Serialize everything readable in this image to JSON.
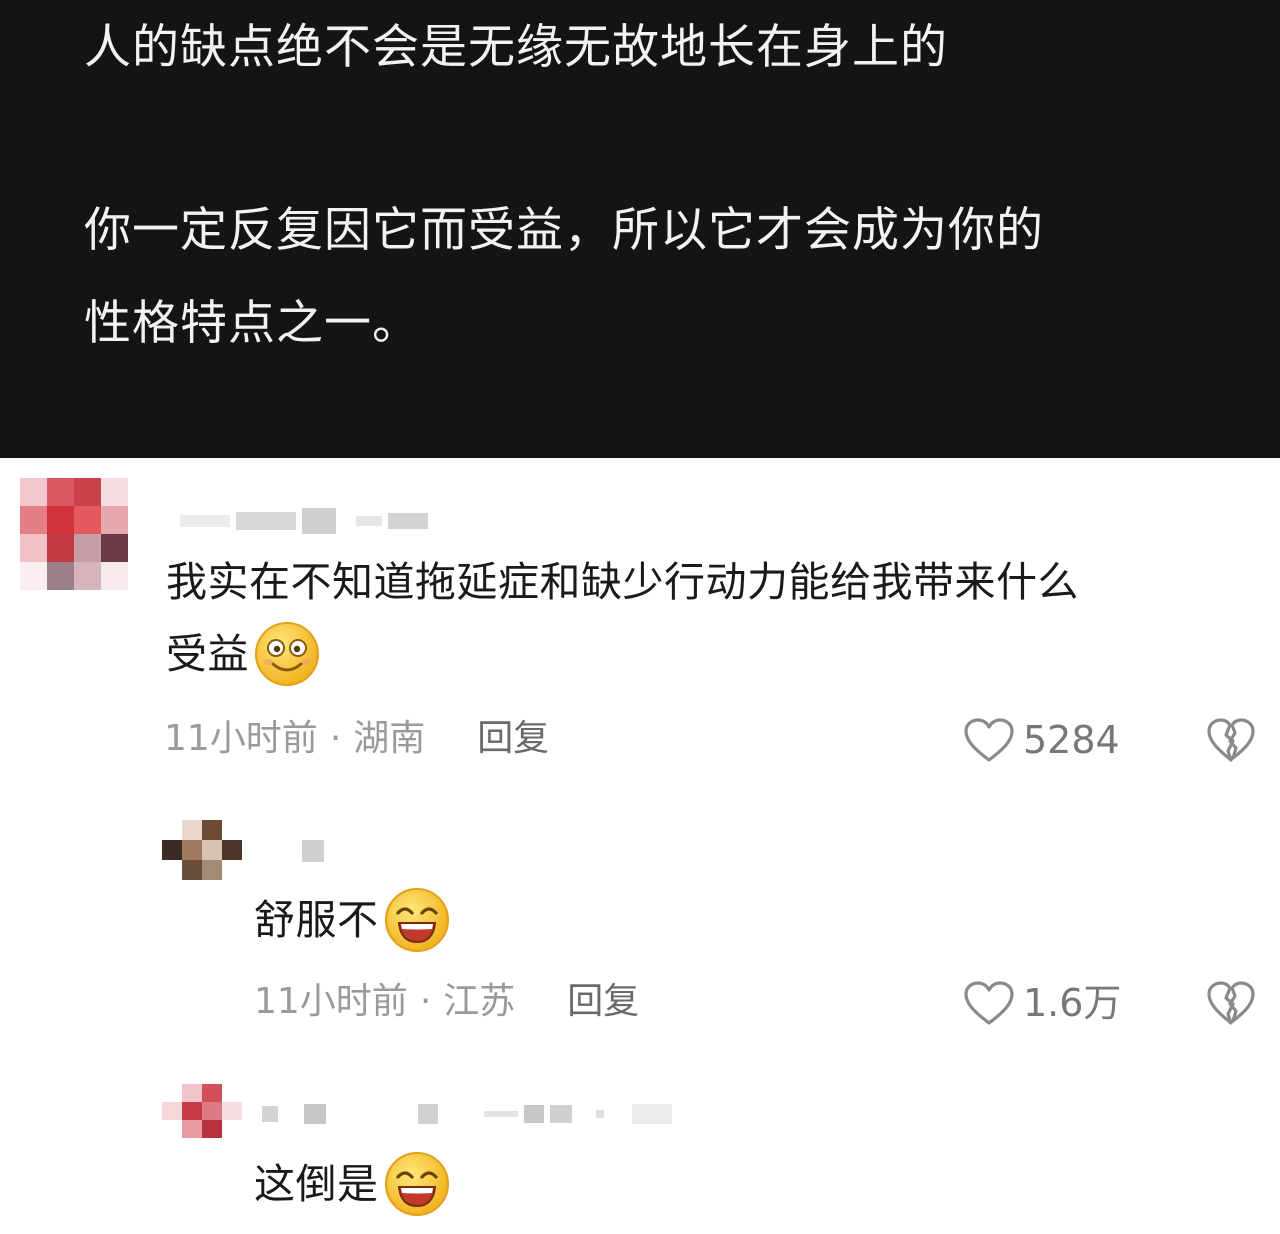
{
  "post": {
    "line1": "人的缺点绝不会是无缘无故地长在身上的",
    "line2": "你一定反复因它而受益，所以它才会成为你的",
    "line3": "性格特点之一。"
  },
  "comments": [
    {
      "text_line1": "我实在不知道拖延症和缺少行动力能给我带来什么",
      "text_line2": "受益",
      "emoji": "smiling-face-emoji",
      "time": "11小时前",
      "separator": "·",
      "location": "湖南",
      "reply_label": "回复",
      "likes": "5284"
    },
    {
      "text": "舒服不",
      "emoji": "grinning-face-emoji",
      "time": "11小时前",
      "separator": "·",
      "location": "江苏",
      "reply_label": "回复",
      "likes": "1.6万"
    },
    {
      "text": "这倒是",
      "emoji": "grinning-face-emoji"
    }
  ],
  "colors": {
    "panel_bg": "#141414",
    "text_primary": "#1a1a1a",
    "text_meta": "#9a9a9a"
  }
}
